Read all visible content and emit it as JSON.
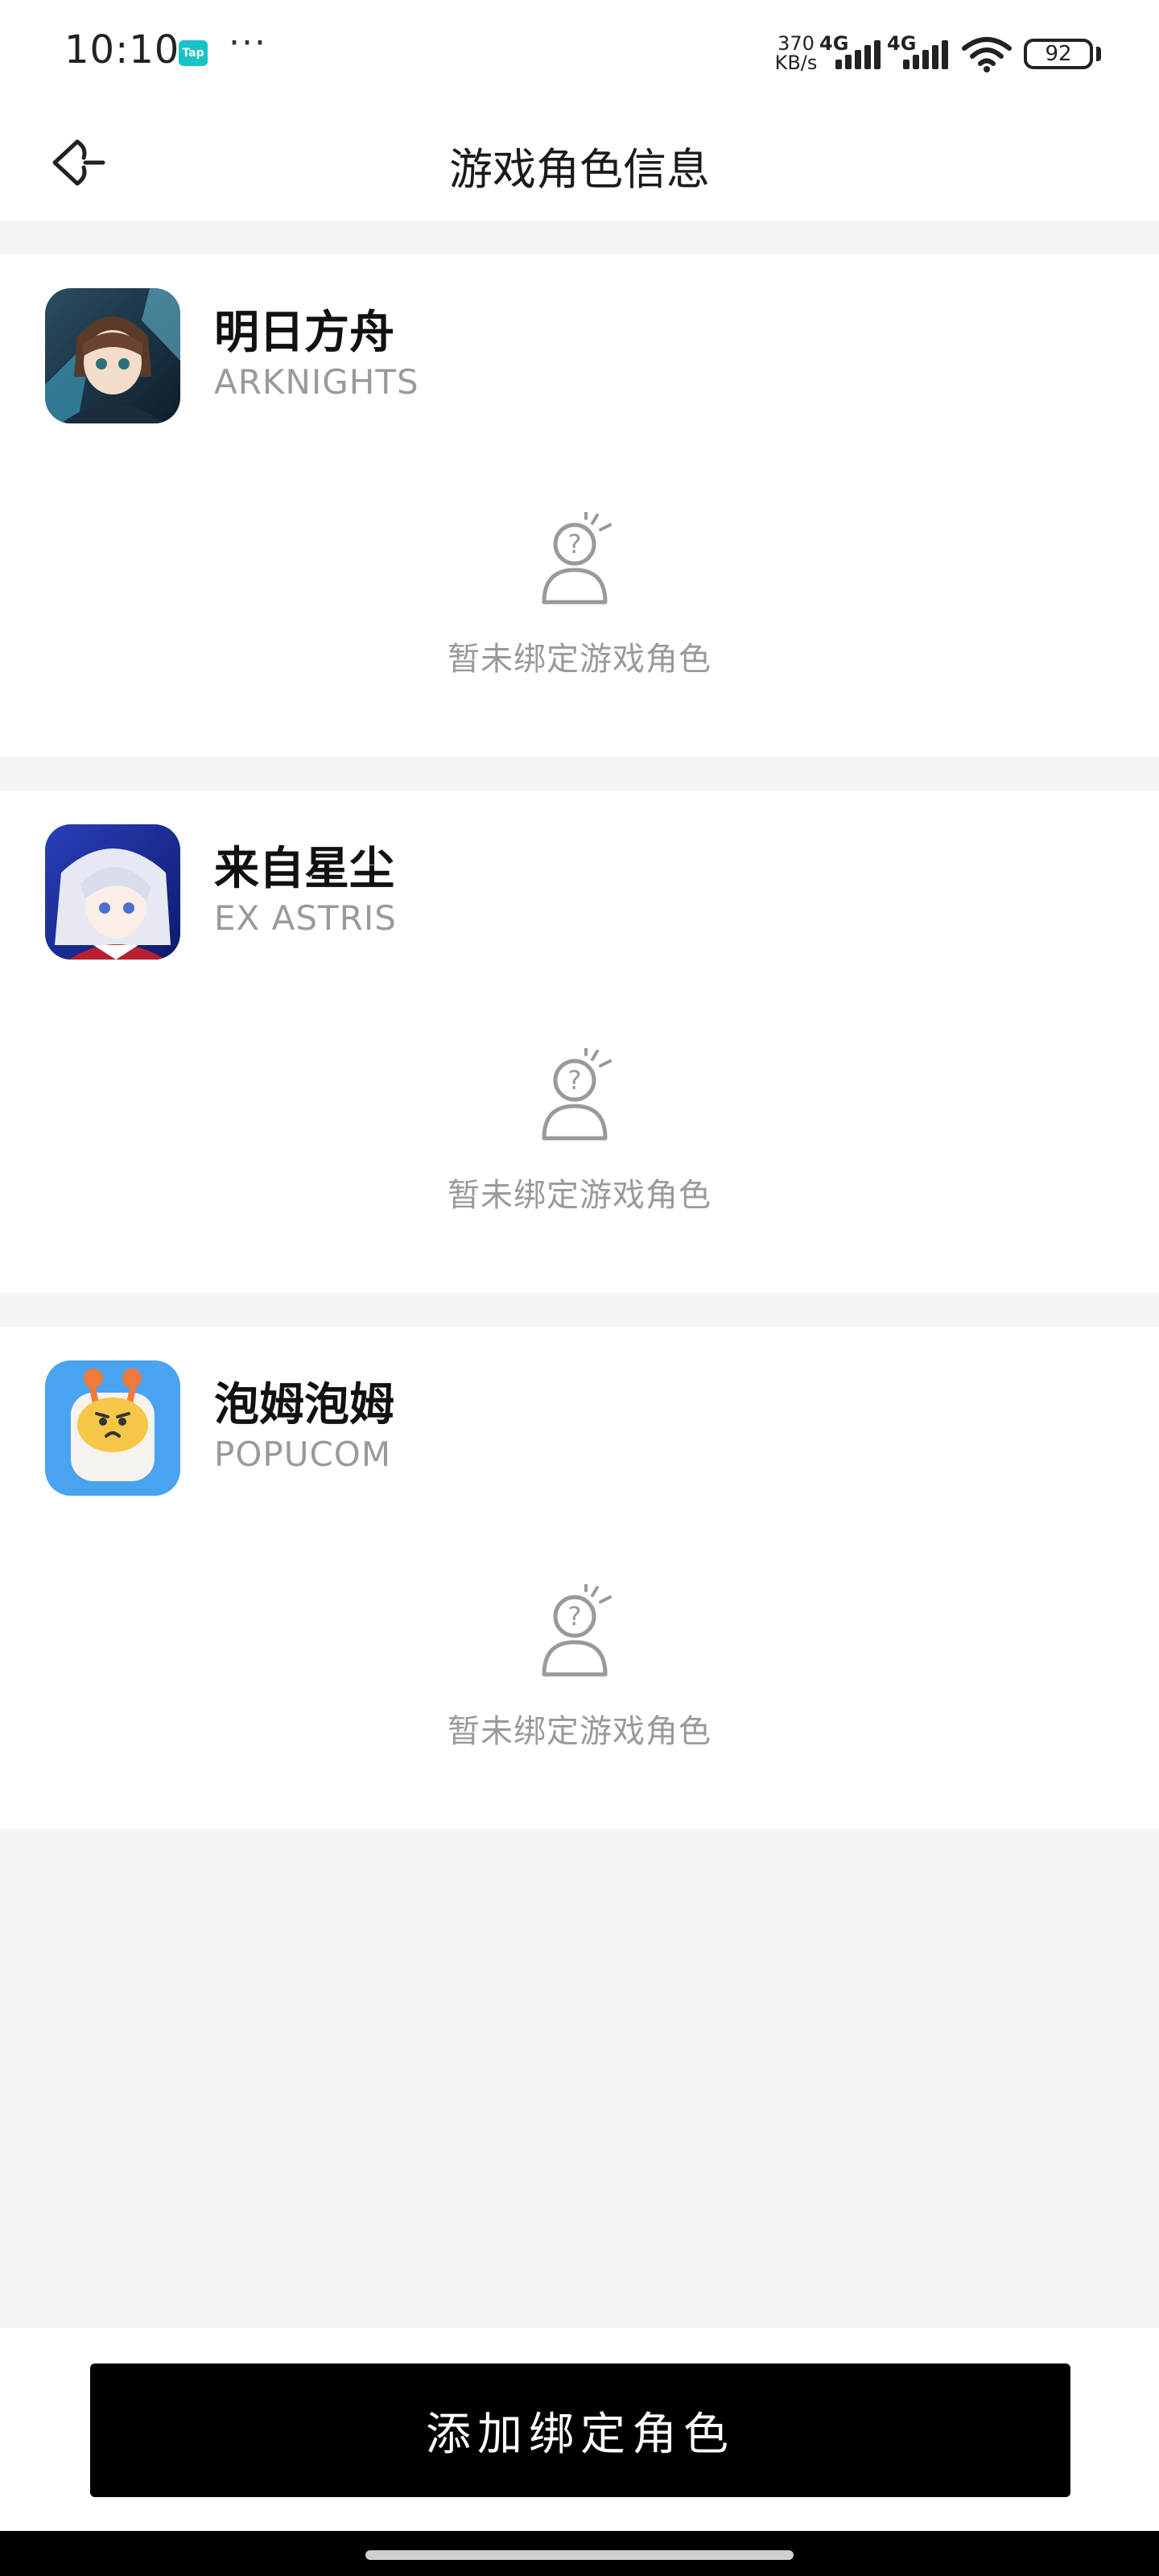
{
  "status_bar": {
    "time": "10:10",
    "tap_badge": "Tap",
    "more": "···",
    "speed_value": "370",
    "speed_unit": "KB/s",
    "network1": "4G",
    "network2": "4G",
    "battery": "92"
  },
  "header": {
    "title": "游戏角色信息",
    "back_icon": "back-arrow-icon"
  },
  "games": [
    {
      "title": "明日方舟",
      "subtitle": "ARKNIGHTS",
      "empty_text": "暂未绑定游戏角色",
      "icon": "arknights-game-icon"
    },
    {
      "title": "来自星尘",
      "subtitle": "EX ASTRIS",
      "empty_text": "暂未绑定游戏角色",
      "icon": "ex-astris-game-icon"
    },
    {
      "title": "泡姆泡姆",
      "subtitle": "POPUCOM",
      "empty_text": "暂未绑定游戏角色",
      "icon": "popucom-game-icon"
    }
  ],
  "bottom": {
    "add_button": "添加绑定角色"
  },
  "colors": {
    "background": "#f3f4f8",
    "card": "#ffffff",
    "muted_text": "#9a9a9a",
    "button": "#000000"
  }
}
